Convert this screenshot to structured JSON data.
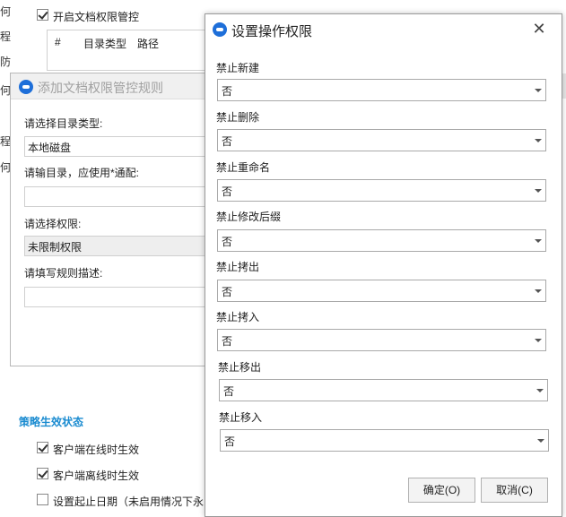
{
  "background": {
    "edge_chars": [
      "何",
      "程",
      "防",
      "何",
      "程",
      "何"
    ],
    "enable_control_label": "开启文档权限管控",
    "table_headers": [
      "#",
      "目录类型",
      "路径"
    ],
    "section_title": "策略生效状态",
    "options": [
      {
        "label": "客户端在线时生效",
        "checked": true
      },
      {
        "label": "客户端离线时生效",
        "checked": true
      },
      {
        "label": "设置起止日期（未启用情况下永",
        "checked": false
      }
    ]
  },
  "rule_dialog": {
    "title": "添加文档权限管控规则",
    "dir_type_label": "请选择目录类型:",
    "dir_type_value": "本地磁盘",
    "dir_input_label": "请输目录，应使用*通配:",
    "dir_input_value": "",
    "perm_label": "请选择权限:",
    "perm_value": "未限制权限",
    "desc_label": "请填写规则描述:",
    "desc_value": ""
  },
  "perm_dialog": {
    "title": "设置操作权限",
    "fields": [
      {
        "label": "禁止新建",
        "value": "否"
      },
      {
        "label": "禁止删除",
        "value": "否"
      },
      {
        "label": "禁止重命名",
        "value": "否"
      },
      {
        "label": "禁止修改后缀",
        "value": "否"
      },
      {
        "label": "禁止拷出",
        "value": "否"
      },
      {
        "label": "禁止拷入",
        "value": "否"
      },
      {
        "label": "禁止移出",
        "value": "否"
      },
      {
        "label": "禁止移入",
        "value": "否"
      }
    ],
    "ok_label": "确定(O)",
    "cancel_label": "取消(C)"
  },
  "colors": {
    "accent": "#1a8bd0",
    "logo": "#1e6fd9"
  },
  "icons": {
    "logo": "app-logo-icon",
    "close": "close-icon",
    "dropdown": "chevron-down-icon",
    "check": "checkbox-icon"
  }
}
